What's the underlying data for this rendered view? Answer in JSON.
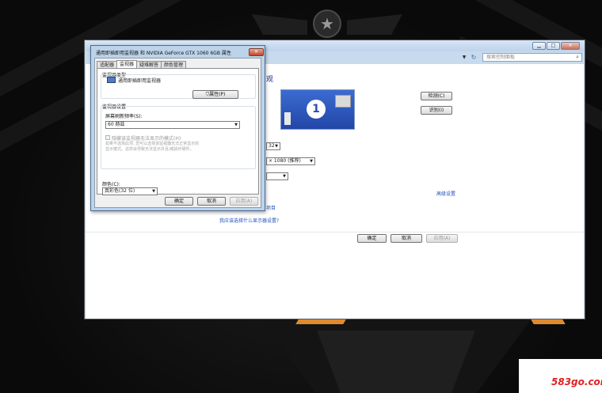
{
  "desktop": {
    "emblem_icon": "star-emblem-icon"
  },
  "control_panel": {
    "search_placeholder": "搜索控制面板",
    "window_buttons": [
      "▁",
      "□",
      "✕"
    ],
    "heading": "观",
    "detect_button": "检测(C)",
    "identify_button": "识别(I)",
    "monitor_number": "1",
    "display_select": "32",
    "resolution_select": "× 1080 (推荐)",
    "advanced_link": "高级设置",
    "partial_link": "项目",
    "help_link": "我应该选择什么显示器设置?",
    "ok_button": "确定",
    "cancel_button": "取消",
    "apply_button": "应用(A)"
  },
  "dialog": {
    "title": "通用即插即用监视器 和 NVIDIA GeForce GTX 1060 6GB 属性",
    "close_label": "✕",
    "tabs": [
      {
        "label": "适配器",
        "active": false
      },
      {
        "label": "监视器",
        "active": true
      },
      {
        "label": "疑难解答",
        "active": false
      },
      {
        "label": "颜色管理",
        "active": false
      }
    ],
    "monitor_type_label": "监视器类型",
    "monitor_name": "通用即插即用监视器",
    "properties_button": "属性(P)",
    "monitor_settings_label": "监视器设置",
    "refresh_rate_label": "屏幕刷新频率(S):",
    "refresh_rate_value": "60 赫兹",
    "hide_modes_label": "隐藏该监视器无法显示的模式(H)",
    "hide_modes_checked": false,
    "warning_lines": [
      "如果不选择此项, 您可以选择该监视器无法正常显示的",
      "显示模式。这样会导致无法显示并且/或损坏硬件。"
    ],
    "colors_label": "颜色(C):",
    "colors_value": "真彩色(32 位)",
    "ok_button": "确定",
    "cancel_button": "取消",
    "apply_button": "应用(A)"
  },
  "watermark": {
    "text": "583go.com"
  }
}
